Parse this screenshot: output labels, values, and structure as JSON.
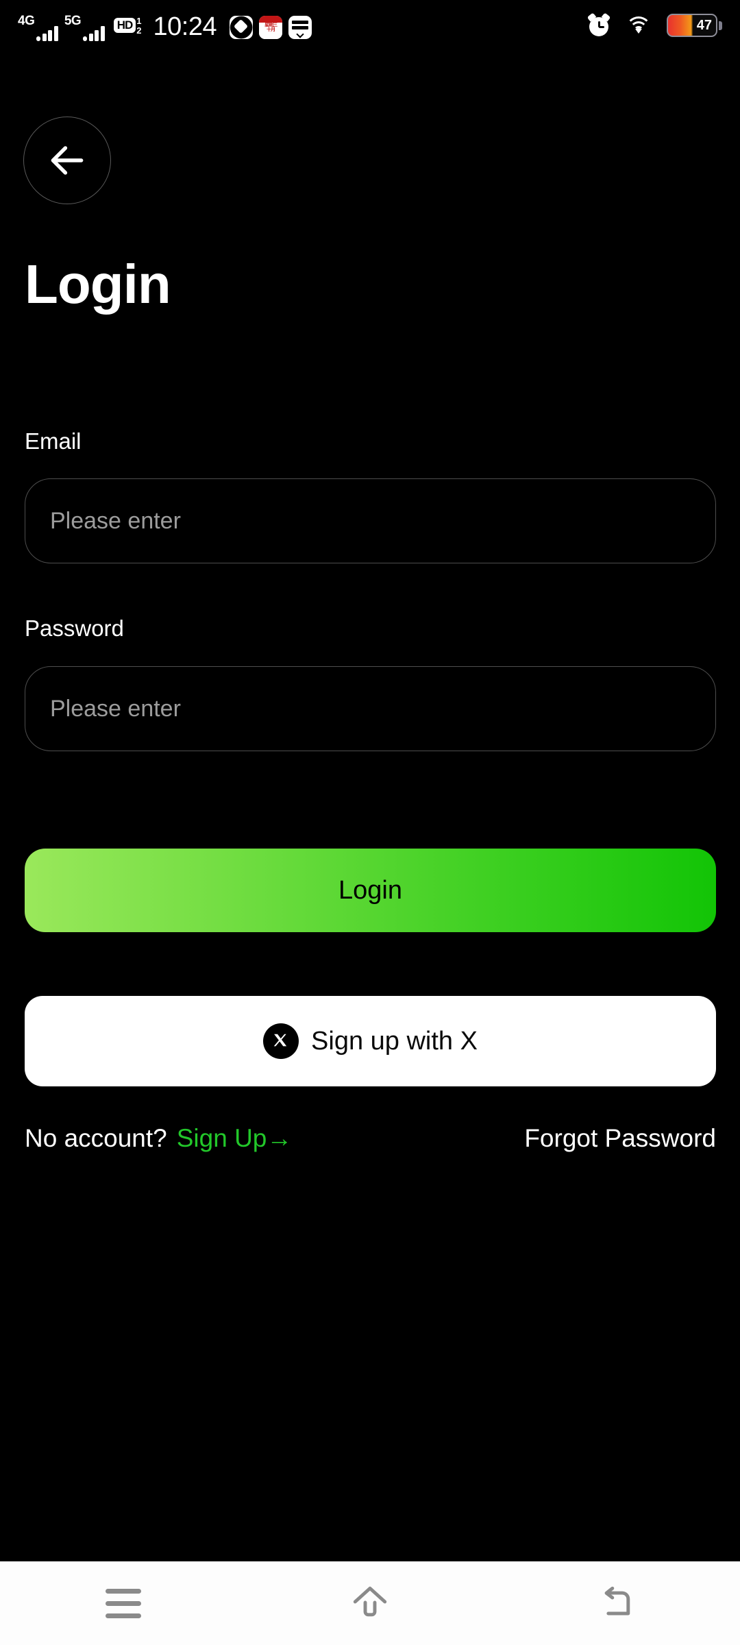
{
  "statusbar": {
    "network_1": "4G",
    "network_2": "5G",
    "hd_label": "HD",
    "hd_sup": "1",
    "hd_sub": "2",
    "time": "10:24",
    "battery_percent": "47",
    "icons": [
      "volte-icon",
      "calendar-icon",
      "wallet-icon",
      "alarm-icon",
      "wifi-icon",
      "battery-icon"
    ]
  },
  "header": {
    "back_icon": "arrow-left-icon",
    "title": "Login"
  },
  "form": {
    "email": {
      "label": "Email",
      "value": "",
      "placeholder": "Please enter"
    },
    "password": {
      "label": "Password",
      "value": "",
      "placeholder": "Please enter"
    }
  },
  "actions": {
    "login_label": "Login",
    "x_signup_label": "Sign up with X",
    "x_logo_glyph": "✕"
  },
  "links": {
    "no_account_text": "No account?",
    "signup_label": "Sign Up→",
    "forgot_label": "Forgot Password"
  },
  "navbar": {
    "recents_icon": "menu-icon",
    "home_icon": "home-icon",
    "back_icon": "back-arrow-icon"
  },
  "colors": {
    "background": "#000000",
    "accent_green": "#22c72a",
    "login_gradient_start": "#9ae85b",
    "login_gradient_end": "#12c406",
    "text_primary": "#ffffff",
    "placeholder": "#9c9c9c",
    "input_border": "#4e4e4e",
    "navbar_bg": "#fdfdfd",
    "navbar_icon": "#8a8a8a"
  }
}
